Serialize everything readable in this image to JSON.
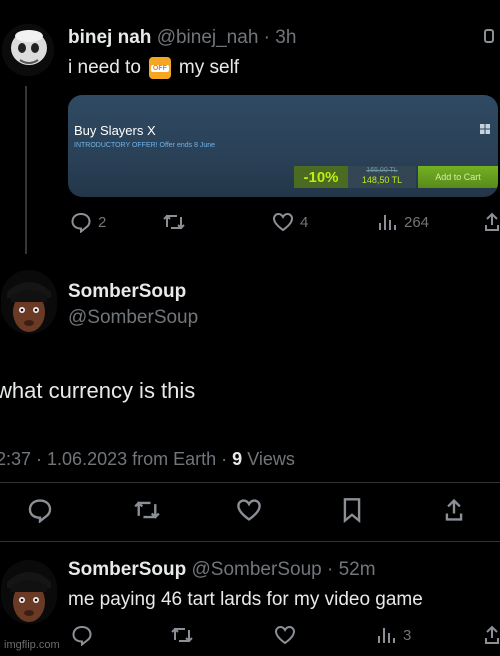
{
  "tweet1": {
    "display_name": "binej nah",
    "handle": "@binej_nah",
    "time": "· 3h",
    "text_before": "i need to",
    "emoji_label": "OFF",
    "text_after": "my self",
    "card": {
      "title": "Buy Slayers X",
      "promo": "INTRODUCTORY OFFER! Offer ends 8 June",
      "discount": "-10%",
      "old_price": "165,00 TL",
      "new_price": "148,50 TL",
      "cart_button": "Add to Cart"
    },
    "actions": {
      "replies": "2",
      "retweets": "",
      "likes": "4",
      "views": "264"
    }
  },
  "tweet2": {
    "display_name": "SomberSoup",
    "handle": "@SomberSoup",
    "text": "what currency is this",
    "timestamp": "2:37 · 1.06.2023 from Earth ·",
    "views_count": "9",
    "views_label": "Views"
  },
  "tweet3": {
    "display_name": "SomberSoup",
    "handle": "@SomberSoup",
    "time": "· 52m",
    "text": "me paying 46 tart lards for my video game",
    "actions": {
      "views": "3"
    }
  },
  "watermark": "imgflip.com",
  "colors": {
    "background": "#000000",
    "text": "#e7e9ea",
    "muted": "#71767b",
    "discount": "#beee11"
  }
}
